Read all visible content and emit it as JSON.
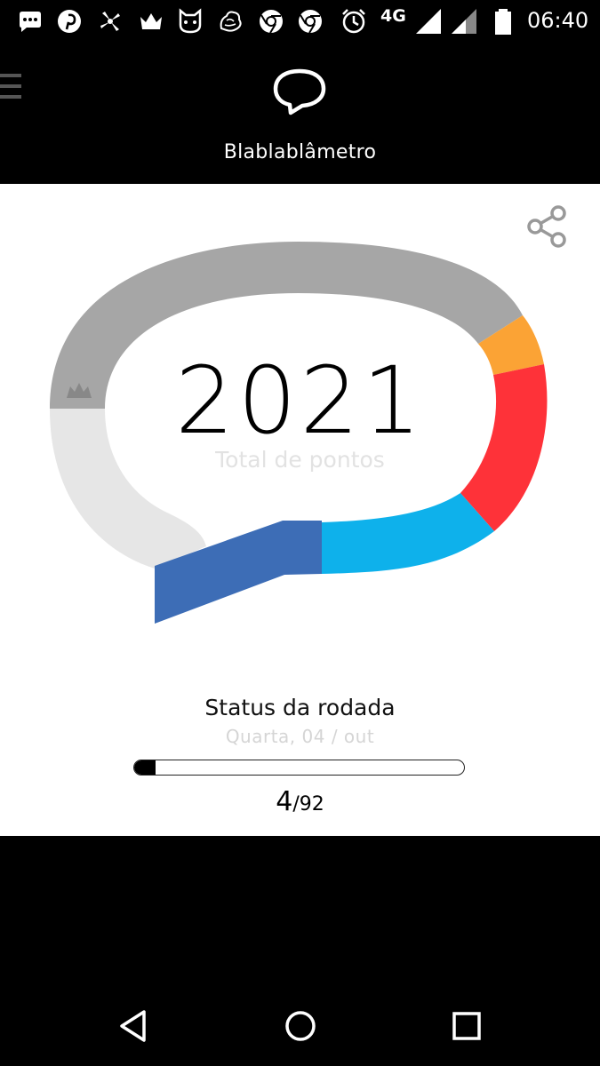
{
  "status_bar": {
    "network": "4G",
    "time": "06:40",
    "notification_icons": [
      "messages-icon",
      "pinterest-icon",
      "windmill-icon",
      "crown-icon",
      "cat-icon",
      "dragon-icon",
      "chrome-icon",
      "chrome-icon",
      "alarm-icon"
    ]
  },
  "app": {
    "title": "Blablablâmetro"
  },
  "meter": {
    "total": "2021",
    "total_label": "Total de pontos",
    "colors": {
      "gray_dark": "#a6a6a6",
      "gray_light": "#e6e6e6",
      "orange": "#fba335",
      "red": "#fe3239",
      "light_blue": "#0eb1eb",
      "dark_blue": "#3d6db6"
    }
  },
  "round_status": {
    "title": "Status da rodada",
    "date": "Quarta, 04 / out",
    "current": "4",
    "separator": "/",
    "total": "92",
    "progress_fraction": 0.0435
  },
  "navigation": {
    "back": "back-icon",
    "home": "home-icon",
    "recents": "recents-icon"
  }
}
